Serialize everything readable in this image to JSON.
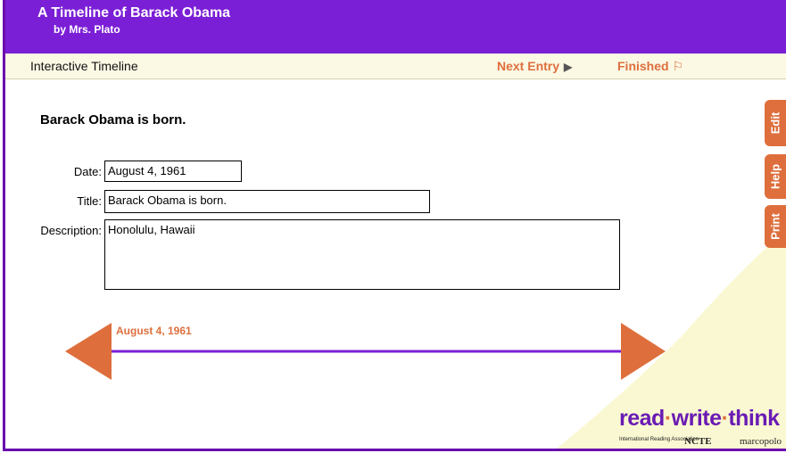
{
  "header": {
    "title": "A Timeline of Barack Obama",
    "author": "by  Mrs. Plato"
  },
  "toolbar": {
    "label": "Interactive Timeline",
    "next_entry": "Next Entry",
    "finished": "Finished"
  },
  "entry": {
    "heading": "Barack Obama is born.",
    "date_label": "Date:",
    "date_value": "August 4, 1961",
    "title_label": "Title:",
    "title_value": "Barack Obama is born.",
    "description_label": "Description:",
    "description_value": "Honolulu, Hawaii"
  },
  "side_tabs": {
    "edit": "Edit",
    "help": "Help",
    "print": "Print"
  },
  "timeline": {
    "date": "August 4, 1961"
  },
  "logo": {
    "name_parts": [
      "read",
      "write",
      "think"
    ],
    "partners": [
      "International Reading Association",
      "NCTE",
      "marcopolo"
    ]
  },
  "colors": {
    "header": "#7b1fd6",
    "accent": "#de6f3d",
    "toolbar": "#fbf8e4",
    "timeline_line": "#7b1fd6",
    "swoosh": "#faf8d2"
  }
}
